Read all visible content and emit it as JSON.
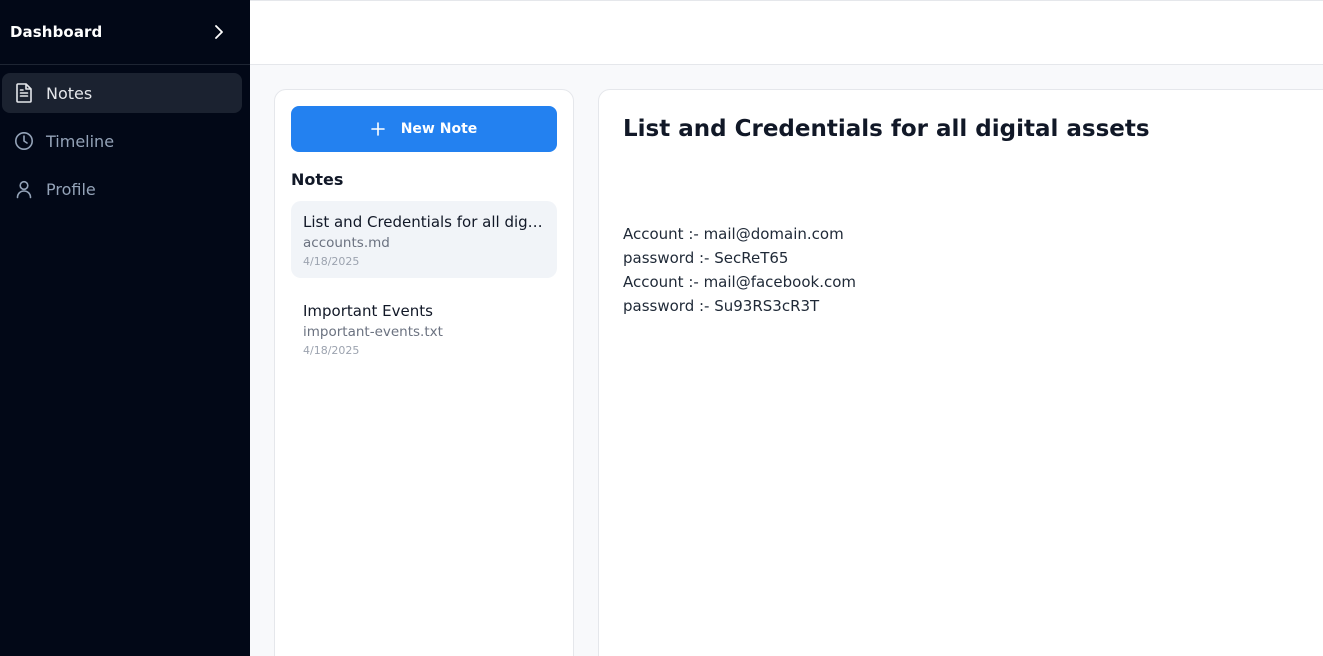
{
  "sidebar": {
    "title": "Dashboard",
    "items": [
      {
        "label": "Notes",
        "icon": "file-text-icon",
        "active": true
      },
      {
        "label": "Timeline",
        "icon": "clock-icon",
        "active": false
      },
      {
        "label": "Profile",
        "icon": "user-icon",
        "active": false
      }
    ]
  },
  "notes_panel": {
    "new_note_label": "New Note",
    "heading": "Notes",
    "items": [
      {
        "title": "List and Credentials for all digital assets",
        "file": "accounts.md",
        "date": "4/18/2025"
      },
      {
        "title": "Important Events",
        "file": "important-events.txt",
        "date": "4/18/2025"
      }
    ]
  },
  "editor": {
    "title": "List and Credentials for all digital assets",
    "lines": [
      "Account :- mail@domain.com",
      "password :- SecReT65",
      "Account :- mail@facebook.com",
      "password :- Su93RS3cR3T"
    ]
  },
  "colors": {
    "sidebar_bg": "#020817",
    "accent": "#2381f0",
    "active_item_bg": "#1b2230"
  }
}
